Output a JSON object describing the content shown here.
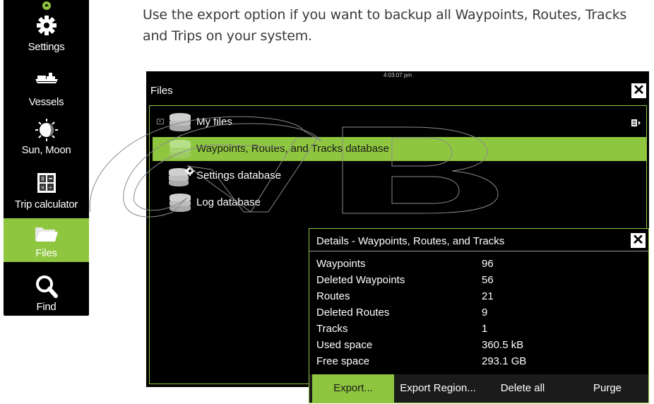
{
  "intro": "Use the export option if you want to backup all Waypoints, Routes, Tracks and Trips on your system.",
  "sidebar": {
    "items": [
      {
        "label": "Settings",
        "icon": "gear-icon"
      },
      {
        "label": "Vessels",
        "icon": "vessel-icon"
      },
      {
        "label": "Sun, Moon",
        "icon": "moon-icon"
      },
      {
        "label": "Trip calculator",
        "icon": "calculator-icon"
      },
      {
        "label": "Files",
        "icon": "folder-icon",
        "active": true
      },
      {
        "label": "Find",
        "icon": "search-icon"
      }
    ]
  },
  "files": {
    "time": "4:03:07 pm",
    "title": "Files",
    "close": "✕",
    "rows": [
      {
        "label": "My files"
      },
      {
        "label": "Waypoints, Routes, and Tracks database",
        "selected": true
      },
      {
        "label": "Settings database"
      },
      {
        "label": "Log database"
      }
    ]
  },
  "details": {
    "title": "Details - Waypoints, Routes, and Tracks",
    "close": "✕",
    "stats": [
      {
        "key": "Waypoints",
        "value": "96"
      },
      {
        "key": "Deleted Waypoints",
        "value": "56"
      },
      {
        "key": "Routes",
        "value": "21"
      },
      {
        "key": "Deleted Routes",
        "value": "9"
      },
      {
        "key": "Tracks",
        "value": "1"
      },
      {
        "key": "Used space",
        "value": "360.5 kB"
      },
      {
        "key": "Free space",
        "value": "293.1 GB"
      }
    ],
    "buttons": [
      "Export...",
      "Export Region...",
      "Delete all",
      "Purge"
    ]
  },
  "colors": {
    "accent": "#8ec63f",
    "background": "#000000"
  }
}
